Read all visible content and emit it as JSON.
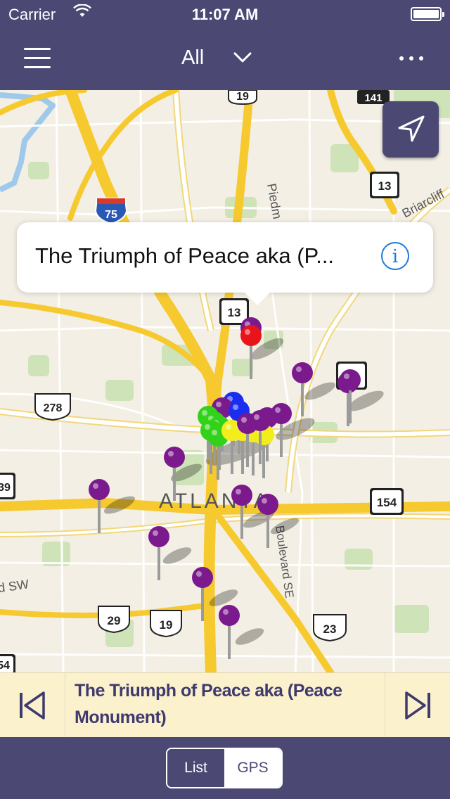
{
  "status_bar": {
    "carrier": "Carrier",
    "time": "11:07 AM"
  },
  "nav": {
    "title": "All",
    "menu_icon": "hamburger-icon",
    "filter_icon": "chevron-down-icon",
    "more_icon": "ellipsis-icon"
  },
  "map": {
    "labels": {
      "city": "ATLANTA",
      "piedmont": "Piedm",
      "briarcliff": "Briarcliff",
      "boulevard": "Boulevard SE",
      "sw": "d SW"
    },
    "shields": {
      "i75": "75",
      "us19_top": "19",
      "ga141": "141",
      "ga13_top": "13",
      "ga13_mid": "13",
      "us278": "278",
      "ga154": "154",
      "us29": "29",
      "us19_bottom": "19",
      "us23": "23",
      "left_139": "39",
      "left_154": "54",
      "ga10": "10"
    },
    "pin_colors": {
      "default": "#7a1a8c",
      "selected": "#e8141a",
      "green": "#32d21a",
      "yellow": "#f2ee1c",
      "blue": "#1b2ef0"
    }
  },
  "locate_button": {
    "icon": "location-arrow-icon"
  },
  "callout": {
    "title": "The Triumph of Peace aka (P...",
    "info_icon_glyph": "i"
  },
  "info_strip": {
    "title": "The Triumph of Peace aka (Peace Monument)"
  },
  "segmented": {
    "list_label": "List",
    "gps_label": "GPS",
    "selected": "GPS"
  }
}
